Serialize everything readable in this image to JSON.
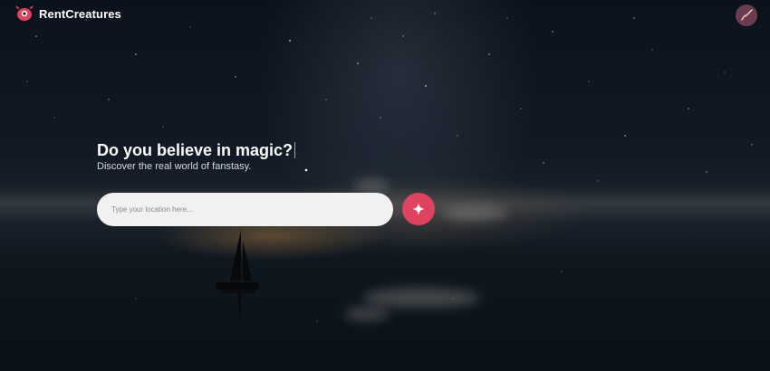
{
  "navbar": {
    "brand_name": "RentCreatures",
    "logo_icon": "creature-logo-icon",
    "avatar_icon": "broom-icon"
  },
  "hero": {
    "title": "Do you believe in magic?",
    "subtitle": "Discover the real world of fanstasy.",
    "search": {
      "placeholder": "Type your location here..."
    },
    "search_button_icon": "sparkle-icon"
  },
  "colors": {
    "accent": "#e0435f",
    "avatar_bg": "#6b3b4f"
  }
}
